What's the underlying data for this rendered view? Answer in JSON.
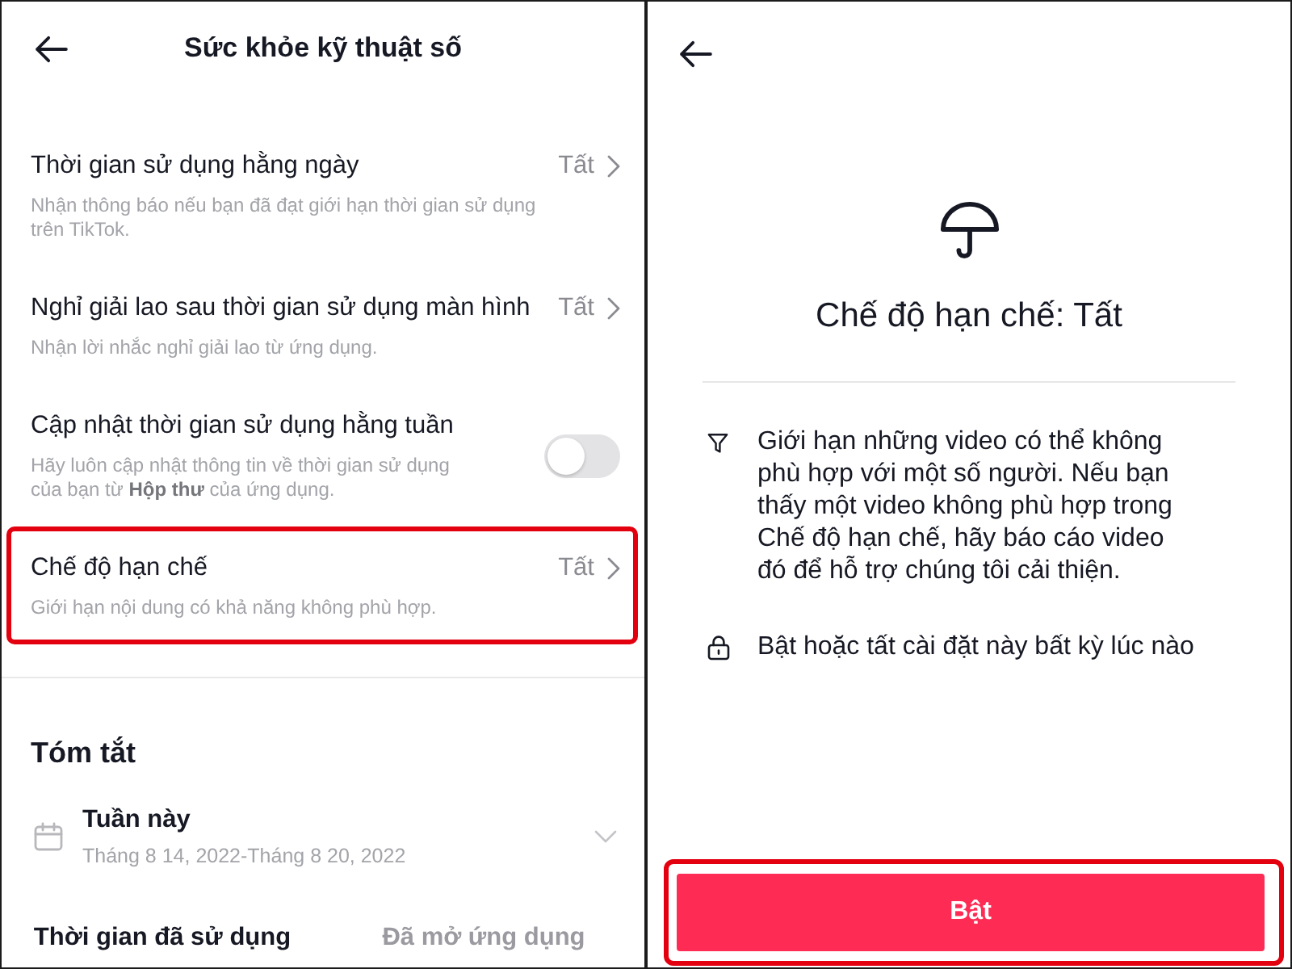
{
  "settings_screen": {
    "title": "Sức khỏe kỹ thuật số",
    "settings": [
      {
        "kind": "link",
        "title": "Thời gian sử dụng hằng ngày",
        "value": "Tất",
        "description": "Nhận thông báo nếu bạn đã đạt giới hạn thời gian sử dụng trên TikTok.",
        "highlighted": false
      },
      {
        "kind": "link",
        "title": "Nghỉ giải lao sau thời gian sử dụng màn hình",
        "value": "Tất",
        "description": "Nhận lời nhắc nghỉ giải lao từ ứng dụng.",
        "highlighted": false
      },
      {
        "kind": "toggle",
        "title": "Cập nhật thời gian sử dụng hằng tuần",
        "on": false,
        "description": "Hãy luôn cập nhật thông tin về thời gian sử dụng của bạn từ **Hộp thư** của ứng dụng.",
        "highlighted": false
      },
      {
        "kind": "link",
        "title": "Chế độ hạn chế",
        "value": "Tất",
        "description": "Giới hạn nội dung có khả năng không phù hợp.",
        "highlighted": true
      }
    ],
    "summary": {
      "heading": "Tóm tắt",
      "period": {
        "label": "Tuần này",
        "dates": "Tháng 8 14, 2022-Tháng 8 20, 2022",
        "expanded": false
      },
      "tabs": [
        {
          "label": "Thời gian đã sử dụng",
          "selected": true
        },
        {
          "label": "Đã mở ứng dụng",
          "selected": false
        }
      ]
    }
  },
  "detail_screen": {
    "title": "Chế độ hạn chế: Tất",
    "points": [
      {
        "kind": "filter",
        "text": "Giới hạn những video có thể không phù hợp với một số người. Nếu bạn thấy một video không phù hợp trong Chế độ hạn chế, hãy báo cáo video đó để hỗ trợ chúng tôi cải thiện."
      },
      {
        "kind": "lock",
        "text": "Bật hoặc tất cài đặt này bất kỳ lúc nào"
      }
    ],
    "button": {
      "label": "Bật",
      "highlighted": true
    }
  }
}
